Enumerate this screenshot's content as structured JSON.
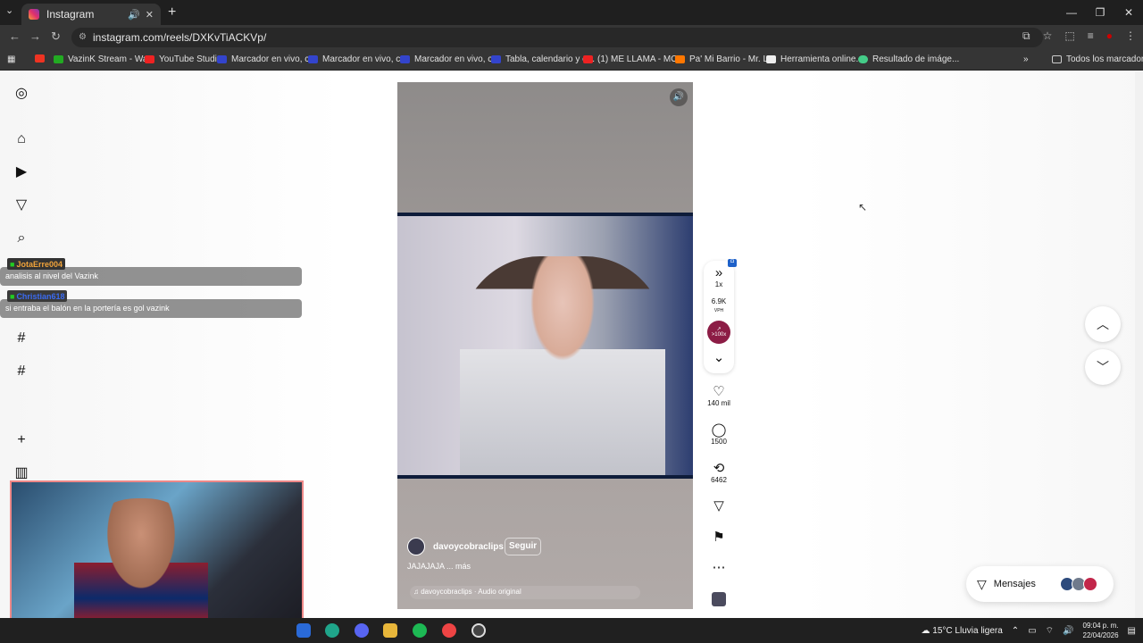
{
  "browser": {
    "tab_title": "Instagram",
    "url": "instagram.com/reels/DXKvTiACKVp/",
    "bookmarks": [
      "VazinK Stream - Wa...",
      "YouTube Studio",
      "Marcador en vivo, c...",
      "Marcador en vivo, c...",
      "Marcador en vivo, c...",
      "Tabla, calendario y e...",
      "(1) ME LLAMA - MO...",
      "Pa' Mi Barrio - Mr. L...",
      "Herramienta online...",
      "Resultado de imáge..."
    ],
    "all_bookmarks": "Todos los marcadores",
    "bookmark_colors": [
      "#e32",
      "#2a2",
      "#e22",
      "#34c",
      "#34c",
      "#34c",
      "#34c",
      "#e22",
      "#f70",
      "#eee",
      "#4c8"
    ]
  },
  "overlay_chat": [
    {
      "user": "JotaErre004",
      "message": "analisis al nivel del Vazink"
    },
    {
      "user": "Christian618",
      "message": "si entraba el balón en la portería es gol vazink"
    }
  ],
  "reel": {
    "username": "davoycobraclips",
    "follow_label": "Seguir",
    "caption": "JAJAJAJA ...",
    "more_label": "más",
    "audio": "davoycobraclips · Audio original"
  },
  "actions": {
    "speed": "1x",
    "vph": "6.9K",
    "vph_label": "VPH",
    "trend": ">100x",
    "likes": "140 mil",
    "comments": "1500",
    "reposts": "6462"
  },
  "messages_label": "Mensajes",
  "taskbar": {
    "weather": "15°C  Lluvia ligera",
    "time": "09:04 p. m.",
    "date": "22/04/2026"
  }
}
